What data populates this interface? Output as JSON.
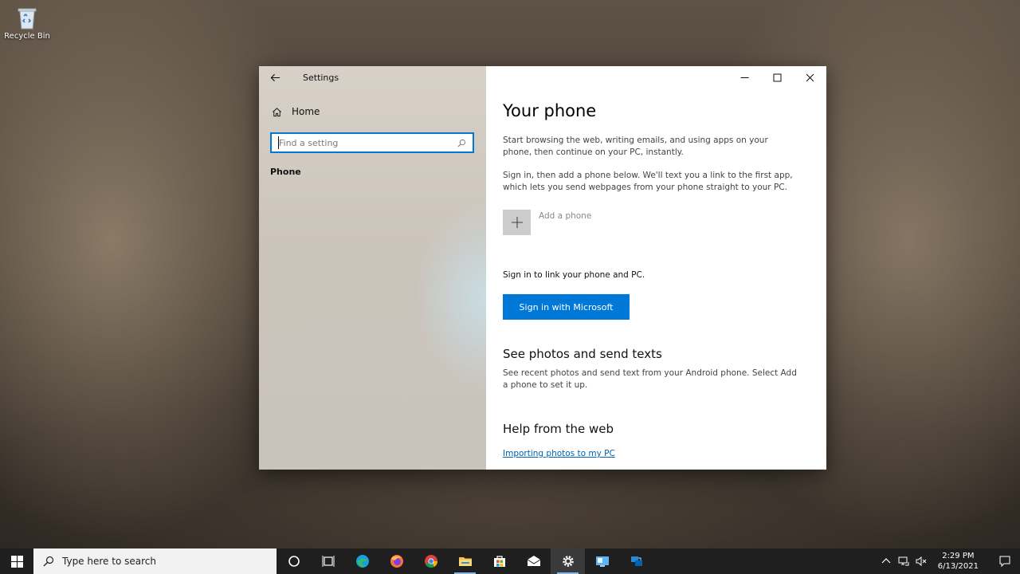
{
  "desktop": {
    "recycle_bin_label": "Recycle Bin"
  },
  "window": {
    "title": "Settings",
    "nav": {
      "home_label": "Home",
      "search_placeholder": "Find a setting",
      "current_section": "Phone"
    },
    "content": {
      "title": "Your phone",
      "intro": "Start browsing the web, writing emails, and using apps on your phone, then continue on your PC, instantly.",
      "signin_info": "Sign in, then add a phone below. We'll text you a link to the first app, which lets you send webpages from your phone straight to your PC.",
      "add_phone_label": "Add a phone",
      "signin_prompt": "Sign in to link your phone and PC.",
      "signin_button": "Sign in with Microsoft",
      "photos_heading": "See photos and send texts",
      "photos_text": "See recent photos and send text from your Android phone. Select Add a phone to set it up.",
      "help_heading": "Help from the web",
      "help_link": "Importing photos to my PC"
    }
  },
  "taskbar": {
    "search_placeholder": "Type here to search",
    "clock_time": "2:29 PM",
    "clock_date": "6/13/2021"
  },
  "colors": {
    "accent": "#0078d7",
    "link": "#0063b1",
    "taskbar": "#1f1f1f"
  }
}
